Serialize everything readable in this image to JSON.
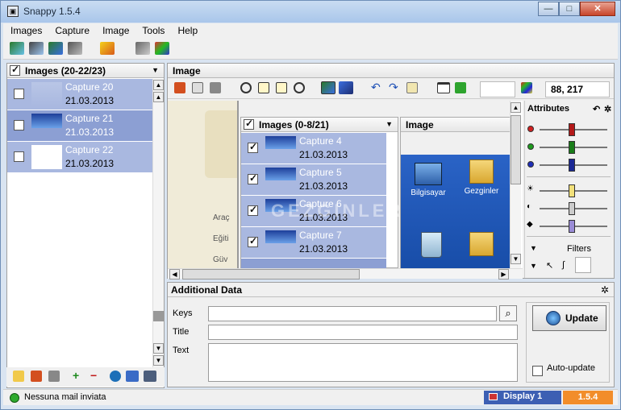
{
  "window": {
    "title": "Snappy 1.5.4",
    "minimize": "—",
    "maximize": "□",
    "close": "✕"
  },
  "menu": [
    "Images",
    "Capture",
    "Image",
    "Tools",
    "Help"
  ],
  "left_panel": {
    "header": "Images (20-22/23)",
    "items": [
      {
        "name": "Capture 20",
        "date": "21.03.2013",
        "selected": false
      },
      {
        "name": "Capture 21",
        "date": "21.03.2013",
        "selected": true
      },
      {
        "name": "Capture 22",
        "date": "21.03.2013",
        "selected": false
      }
    ]
  },
  "image_panel": {
    "header": "Image",
    "coordinates": "88, 217"
  },
  "attributes": {
    "header": "Attributes",
    "filters_label": "Filters"
  },
  "nested": {
    "images_header": "Images (0-8/21)",
    "image_header": "Image",
    "items": [
      {
        "name": "Capture 4",
        "date": "21.03.2013"
      },
      {
        "name": "Capture 5",
        "date": "21.03.2013"
      },
      {
        "name": "Capture 6",
        "date": "21.03.2013"
      },
      {
        "name": "Capture 7",
        "date": "21.03.2013"
      }
    ],
    "desktop": [
      "Bilgisayar",
      "Gezginler"
    ],
    "partial_menu": [
      "Araç",
      "Eğiti",
      "Güv"
    ],
    "watermark": "GEZGINLER"
  },
  "additional_data": {
    "header": "Additional Data",
    "keys_label": "Keys",
    "title_label": "Title",
    "text_label": "Text",
    "update_button": "Update",
    "auto_update_label": "Auto-update"
  },
  "status": {
    "message": "Nessuna mail inviata",
    "display": "Display 1",
    "version": "1.5.4"
  },
  "colors": {
    "selected_row": "#a9b8e0",
    "selected_row_active": "#8c9fd3",
    "display": "#3d5fb3",
    "version": "#f28d2a"
  }
}
